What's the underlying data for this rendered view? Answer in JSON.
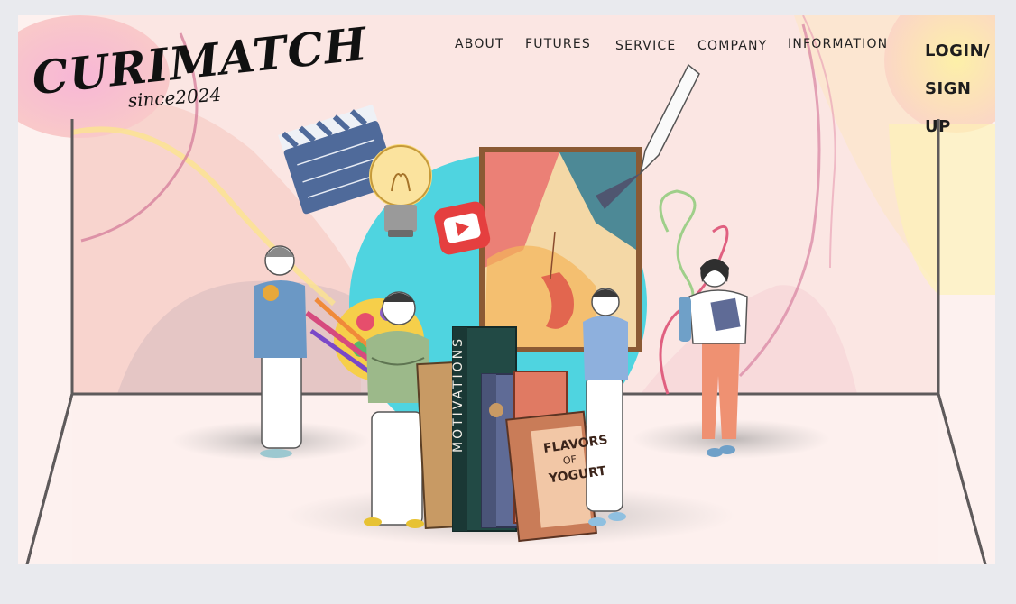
{
  "brand": {
    "name": "CURIMATCH",
    "since": "since2024"
  },
  "nav": {
    "items": [
      {
        "label": "ABOUT"
      },
      {
        "label": "FUTURES"
      },
      {
        "label": "SERVICE"
      },
      {
        "label": "COMPANY"
      },
      {
        "label": "INFORMATION"
      }
    ],
    "login_line1": "LOGIN/",
    "login_line2": "SIGN UP"
  },
  "hero": {
    "book_labels": [
      "MOTIVATIONS",
      "FLAVORS",
      "OF",
      "YOGURT"
    ]
  },
  "colors": {
    "background": "#fdf1ef",
    "accent_cyan": "#4fd4e0",
    "accent_pink": "#f1a3c0",
    "accent_yellow": "#fce78f"
  }
}
